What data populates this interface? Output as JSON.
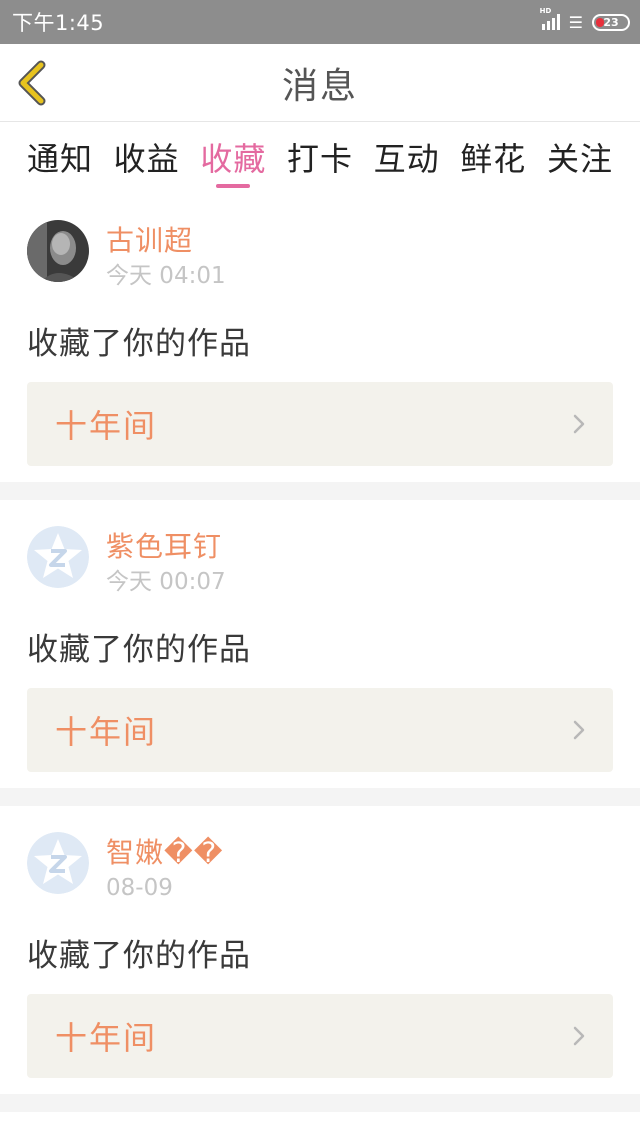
{
  "status_bar": {
    "time": "下午1:45",
    "battery": "23"
  },
  "header": {
    "title": "消息"
  },
  "tabs": [
    {
      "label": "通知",
      "active": false
    },
    {
      "label": "收益",
      "active": false
    },
    {
      "label": "收藏",
      "active": true
    },
    {
      "label": "打卡",
      "active": false
    },
    {
      "label": "互动",
      "active": false
    },
    {
      "label": "鲜花",
      "active": false
    },
    {
      "label": "关注",
      "active": false
    }
  ],
  "messages": [
    {
      "user": "古训超",
      "time": "今天 04:01",
      "action": "收藏了你的作品",
      "work": "十年间",
      "avatar": "photo-avatar"
    },
    {
      "user": "紫色耳钉",
      "time": "今天 00:07",
      "action": "收藏了你的作品",
      "work": "十年间",
      "avatar": "default-z-avatar"
    },
    {
      "user": "智嫩��",
      "time": "08-09",
      "action": "收藏了你的作品",
      "work": "十年间",
      "avatar": "default-z-avatar"
    }
  ],
  "colors": {
    "accent_pink": "#e46aa0",
    "name_orange": "#ef8f64",
    "back_arrow": "#e7c31f",
    "status_bar": "#8d8d8d"
  }
}
